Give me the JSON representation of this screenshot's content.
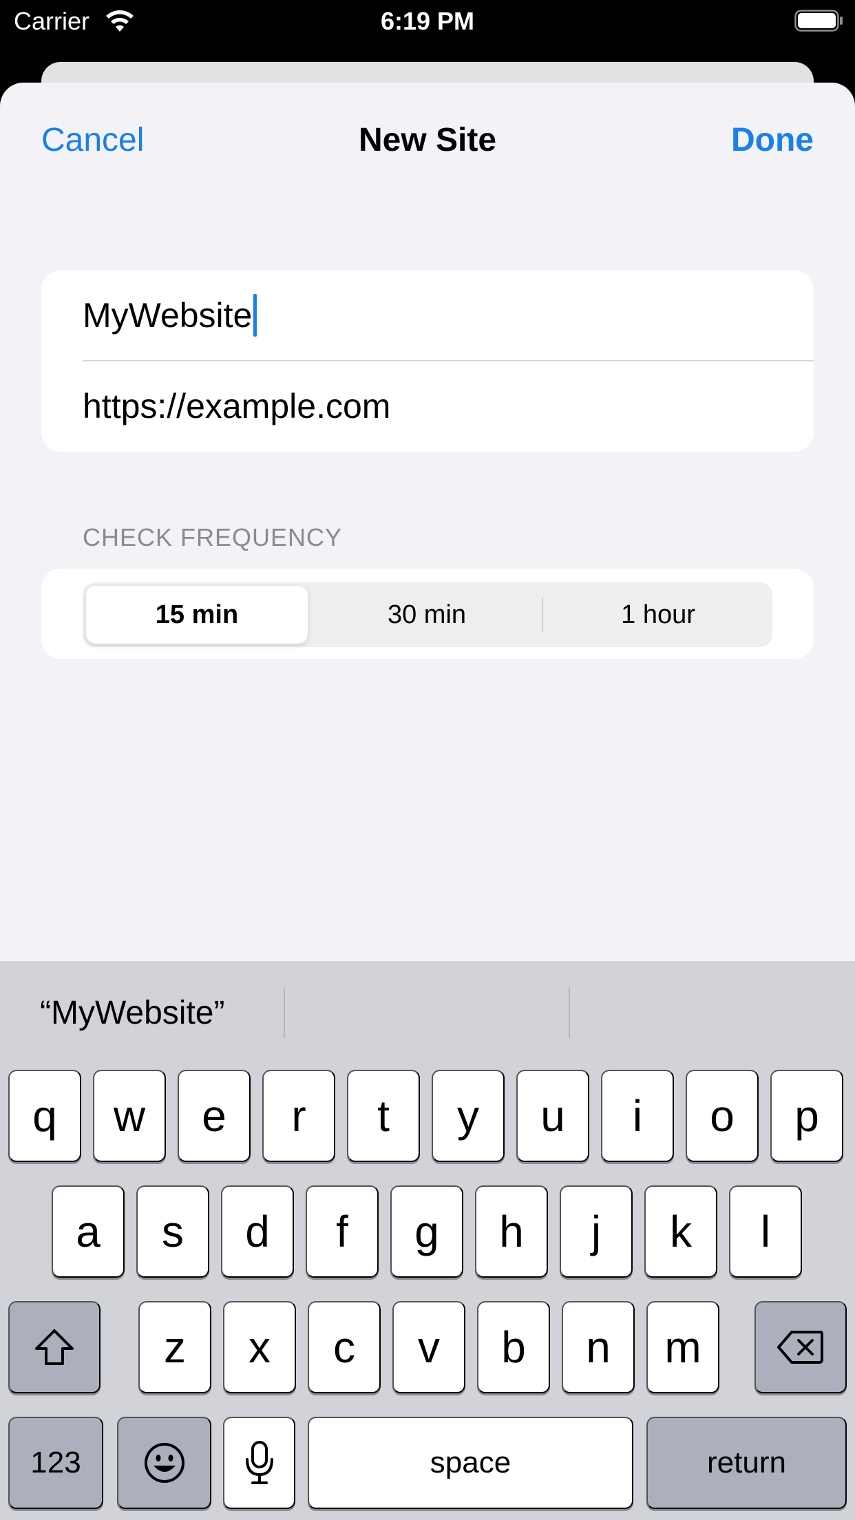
{
  "status_bar": {
    "carrier": "Carrier",
    "time": "6:19 PM",
    "wifi_icon": "wifi-icon",
    "battery_icon": "battery-icon"
  },
  "nav": {
    "cancel_label": "Cancel",
    "title": "New Site",
    "done_label": "Done"
  },
  "form": {
    "name_value": "MyWebsite",
    "url_value": "https://example.com"
  },
  "frequency": {
    "header": "CHECK FREQUENCY",
    "options": [
      "15 min",
      "30 min",
      "1 hour"
    ],
    "selected": "15 min"
  },
  "keyboard": {
    "suggestions": [
      "“MyWebsite”",
      "",
      ""
    ],
    "row1": [
      "q",
      "w",
      "e",
      "r",
      "t",
      "y",
      "u",
      "i",
      "o",
      "p"
    ],
    "row2": [
      "a",
      "s",
      "d",
      "f",
      "g",
      "h",
      "j",
      "k",
      "l"
    ],
    "row3": [
      "z",
      "x",
      "c",
      "v",
      "b",
      "n",
      "m"
    ],
    "numbers_label": "123",
    "space_label": "space",
    "return_label": "return",
    "icons": [
      "shift-icon",
      "backspace-icon",
      "emoji-icon",
      "microphone-icon"
    ]
  },
  "colors": {
    "accent": "#1a7fe8",
    "sheet_background": "#f2f2f7",
    "keyboard_background": "#d1d3d9"
  }
}
